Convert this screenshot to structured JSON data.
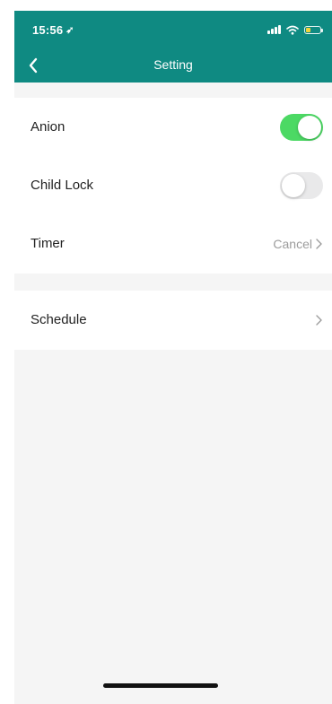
{
  "status_bar": {
    "time": "15:56",
    "location_glyph": "➶"
  },
  "nav": {
    "title": "Setting",
    "back_icon": "chevron-left-icon"
  },
  "settings": {
    "anion": {
      "label": "Anion",
      "enabled": true
    },
    "child_lock": {
      "label": "Child Lock",
      "enabled": false
    },
    "timer": {
      "label": "Timer",
      "value": "Cancel"
    },
    "schedule": {
      "label": "Schedule"
    }
  },
  "colors": {
    "header": "#0f8a82",
    "toggle_on": "#4cd964",
    "toggle_off": "#e9e9ea",
    "background": "#f5f5f5"
  }
}
